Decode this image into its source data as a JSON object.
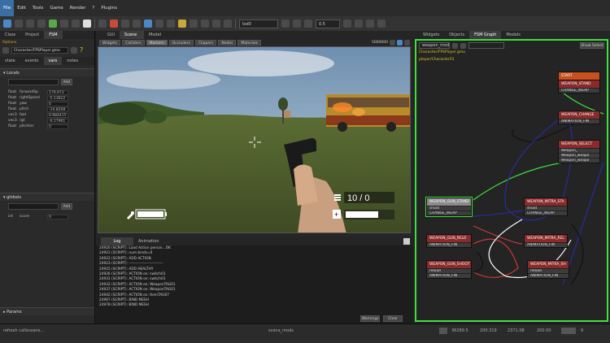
{
  "menubar": {
    "items": [
      "File",
      "Edit",
      "Tools",
      "Game",
      "Render",
      "?",
      "Plugins"
    ]
  },
  "toolbar": {
    "layer_dropdown": "lod0",
    "snap_value": "0.5"
  },
  "left_panel": {
    "tabs": [
      "Class",
      "Project",
      "FSM"
    ],
    "options_label": "Options",
    "fsm_file": "Character/FPSPlayer.gmo",
    "subtabs": [
      "state",
      "events",
      "vars",
      "notes"
    ],
    "locals_header": "Locals",
    "add_label": "Add",
    "locals": [
      {
        "type": "float",
        "name": "forwardSp",
        "value": "179.973"
      },
      {
        "type": "float",
        "name": "rightSpeed",
        "value": "-5.13622"
      },
      {
        "type": "float",
        "name": "yaw",
        "value": "0"
      },
      {
        "type": "float",
        "name": "pitch",
        "value": "-14.8208"
      },
      {
        "type": "vec3",
        "name": "fwd",
        "value": "0.984415"
      },
      {
        "type": "vec3",
        "name": "rgt",
        "value": "-0.17961"
      },
      {
        "type": "float",
        "name": "pitchInc",
        "value": "0"
      }
    ],
    "globals_header": "globals",
    "globals": [
      {
        "type": "int",
        "name": "score",
        "value": "0"
      }
    ],
    "params_header": "Params"
  },
  "center": {
    "tabs": [
      "GUI",
      "Scene",
      "Model"
    ],
    "scene_toolbar": [
      "Widgets",
      "Colliders",
      "Markers",
      "Occluders",
      "Clippers",
      "Nodes",
      "Materials"
    ],
    "scene_value": "5000000",
    "hud": {
      "ammo": "10 / 0",
      "health_pct": 1.0
    },
    "console_tabs": [
      "Log",
      "Animation"
    ],
    "log_lines": [
      "24920 (SCRIPT): Load Action person...OK",
      "24921 (SCRIPT): num binds=0",
      "24922 (SCRIPT): ADD ACTION",
      "24923 (SCRIPT): ---------------------------",
      "24925 (SCRIPT): ADD HEALTHY",
      "24926 (SCRIPT): ACTION on: switch01",
      "24931 (SCRIPT): ACTION on: switch01",
      "24932 (SCRIPT): ACTION on: WeaponTAG01",
      "24937 (SCRIPT): ACTION on: WeaponTAG01",
      "24942 (SCRIPT): ACTION on: ItemTAG07",
      "24967 (SCRIPT): BIND MESH",
      "24978 (SCRIPT): BIND MESH"
    ],
    "warnings_label": "Warnings",
    "clear_label": "Clear"
  },
  "fsm_panel": {
    "tabs": [
      "Widgets",
      "Objects",
      "FSM Graph",
      "Models"
    ],
    "dropdown": "weapon_mod",
    "show_select": "Show Select",
    "file": "Character/FPSPlayer.gmo",
    "instance": "player/Character01",
    "nodes": [
      {
        "id": "start",
        "title": "START",
        "events": []
      },
      {
        "id": "stand",
        "title": "WEAPON_STAND",
        "events": [
          "CHANGE_WEAP"
        ]
      },
      {
        "id": "change",
        "title": "WEAPON_CHANGE",
        "events": [
          "ANIMATION_FIN"
        ]
      },
      {
        "id": "select",
        "title": "WEAPON_SELECT",
        "events": [
          "Weapon_",
          "Weapon_weapo",
          "Weapon_weapo"
        ]
      },
      {
        "id": "gunstand",
        "title": "WEAPON_GUN_STAND",
        "events": [
          "shoot",
          "CHANGE_WEAP"
        ]
      },
      {
        "id": "mitrasta",
        "title": "WEAPON_MITRA_STA",
        "events": [
          "shoot",
          "CHANGE_WEAP"
        ]
      },
      {
        "id": "gunrelo",
        "title": "WEAPON_GUN_RELO",
        "events": [
          "ANIMATION_FIN"
        ]
      },
      {
        "id": "mitrarel",
        "title": "WEAPON_MITRA_REL",
        "events": [
          "ANIMATION_FIN"
        ]
      },
      {
        "id": "gunshoot",
        "title": "WEAPON_GUN_SHOOT",
        "events": [
          "reload",
          "ANIMATION_FIN"
        ]
      },
      {
        "id": "mitrash",
        "title": "WEAPON_MITRA_SH",
        "events": [
          "reload",
          "ANIMATION_FIN"
        ]
      }
    ]
  },
  "statusbar": {
    "left": "refresh callsceane...",
    "center": "scena_mods",
    "c1": "36289.5",
    "c2": "200.319",
    "c3": "2371.08",
    "c4": "200.00",
    "c5": "9"
  },
  "colors": {
    "accent": "#3de03d",
    "node_red": "#8a2a2a",
    "node_start": "#c8501e"
  }
}
